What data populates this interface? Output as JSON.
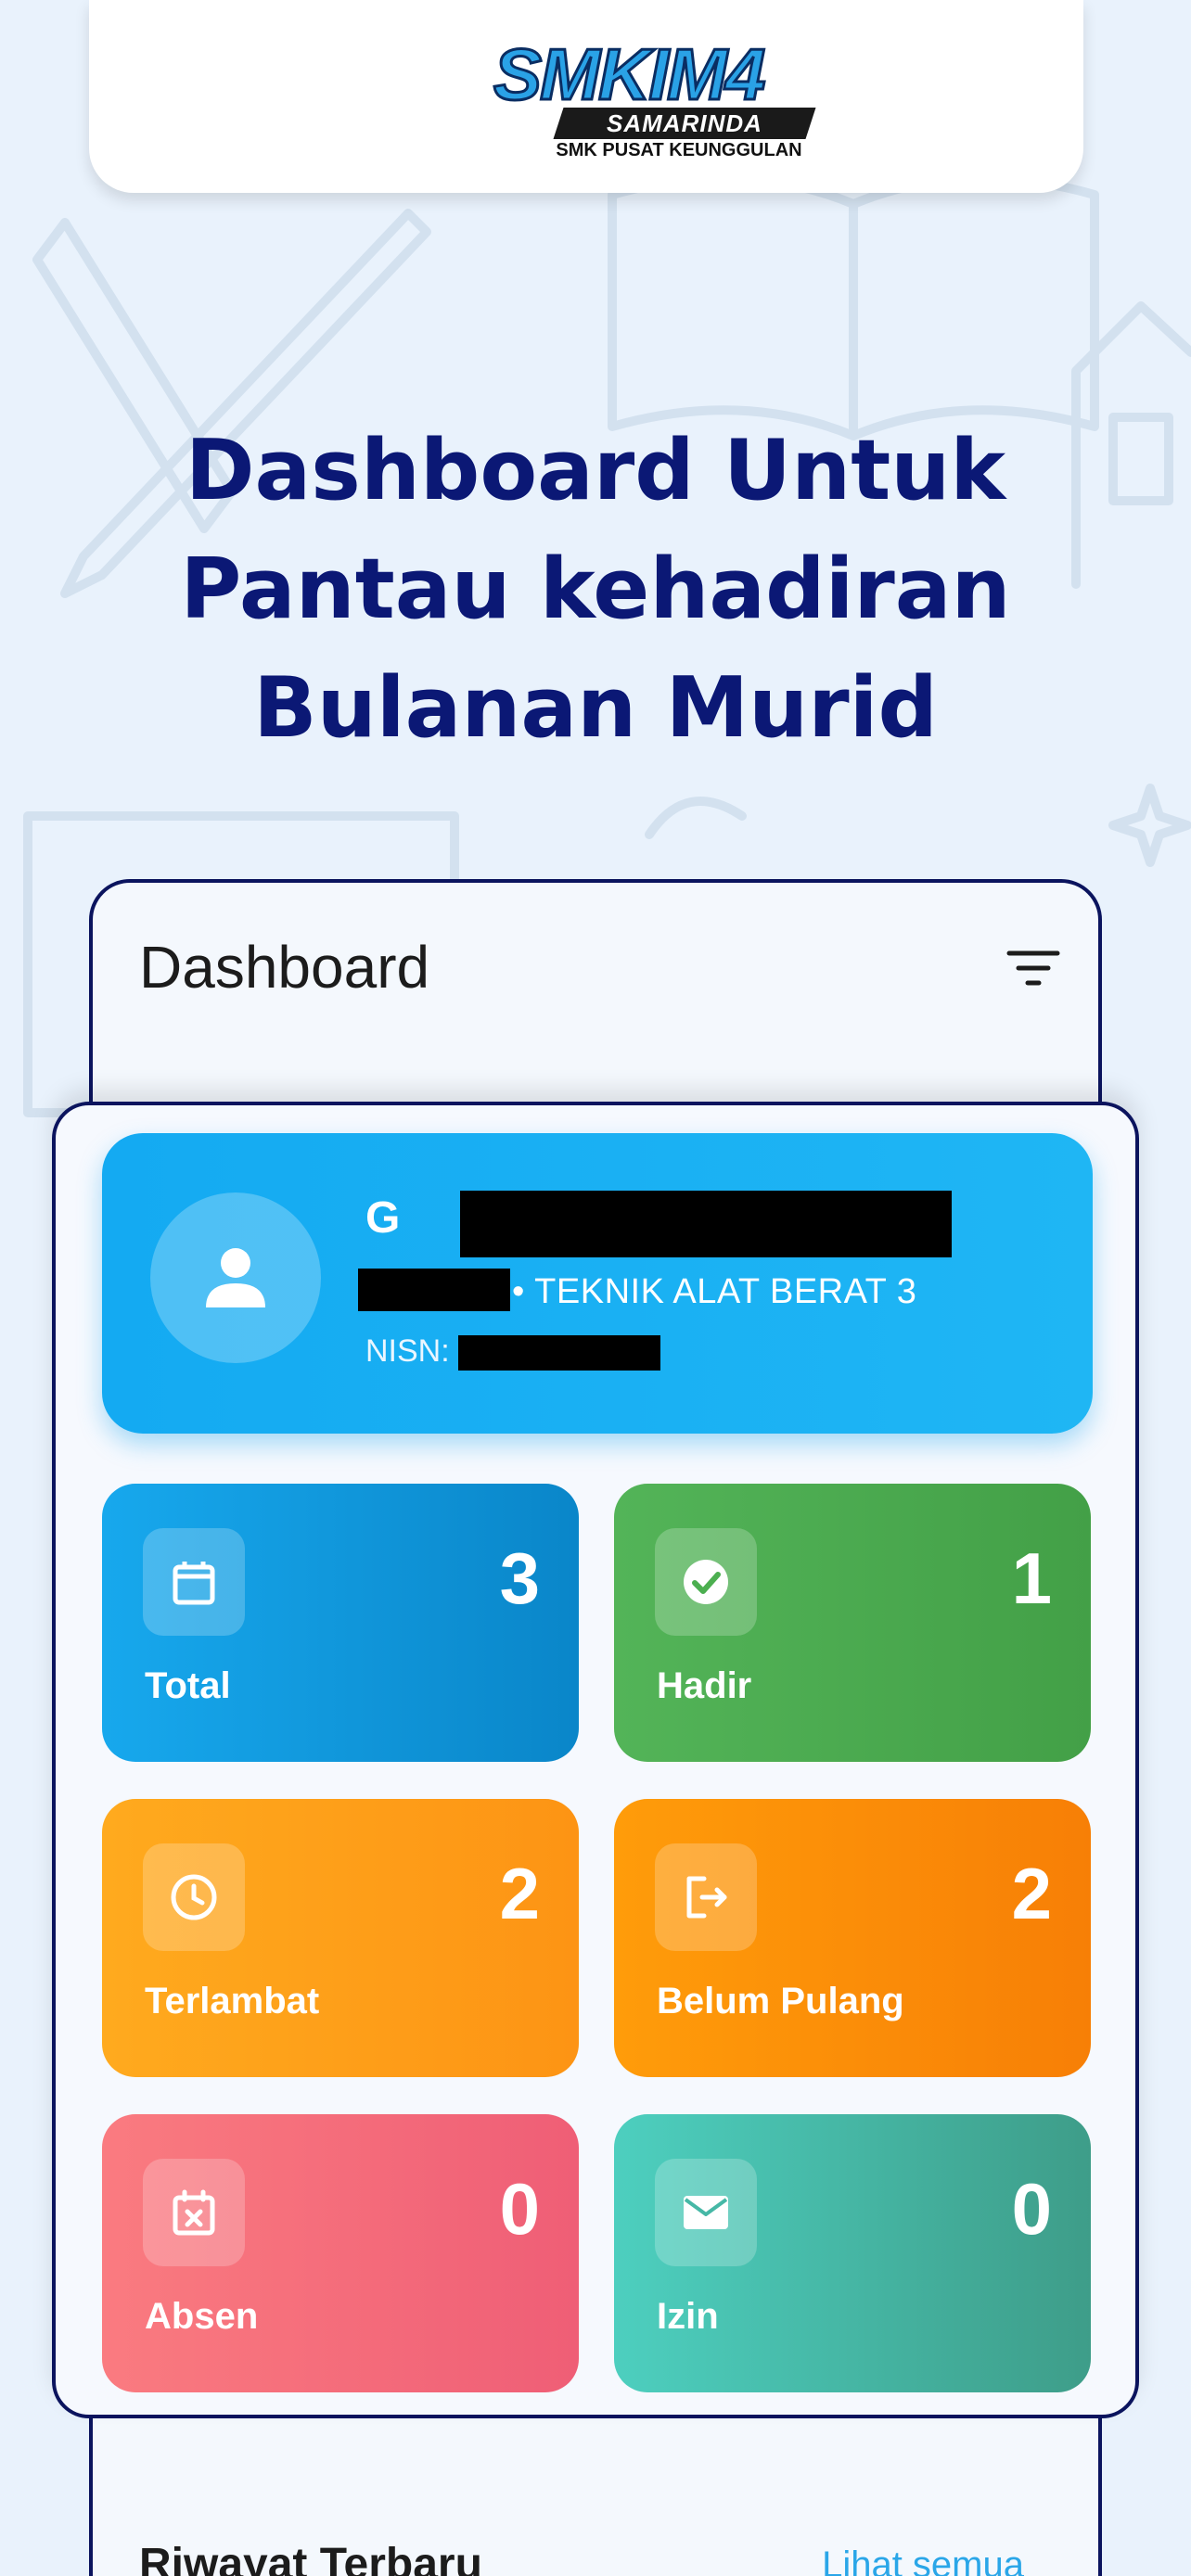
{
  "logo": {
    "main": "SMKIM4",
    "sub": "SAMARINDA",
    "tagline": "SMK PUSAT KEUNGGULAN"
  },
  "headline": {
    "line1": "Dashboard Untuk",
    "line2": "Pantau kehadiran",
    "line3": "Bulanan Murid"
  },
  "phone": {
    "title": "Dashboard",
    "history_title": "Riwayat Terbaru",
    "history_link": "Lihat semua"
  },
  "profile": {
    "name": "G",
    "class": "• TEKNIK ALAT BERAT 3",
    "nisn_label": "NISN:"
  },
  "stats": {
    "total": {
      "value": "3",
      "label": "Total",
      "icon": "calendar-icon"
    },
    "hadir": {
      "value": "1",
      "label": "Hadir",
      "icon": "check-circle-icon"
    },
    "late": {
      "value": "2",
      "label": "Terlambat",
      "icon": "clock-icon"
    },
    "pulang": {
      "value": "2",
      "label": "Belum Pulang",
      "icon": "logout-icon"
    },
    "absen": {
      "value": "0",
      "label": "Absen",
      "icon": "calendar-x-icon"
    },
    "izin": {
      "value": "0",
      "label": "Izin",
      "icon": "mail-icon"
    }
  },
  "colors": {
    "headline": "#0b1875",
    "profile": "#14aaf2",
    "total": "#17a8ed",
    "hadir": "#4caf50",
    "late": "#ffa31a",
    "pulang": "#fb8c0a",
    "absen": "#f46c7b",
    "izin": "#46b8a6"
  }
}
